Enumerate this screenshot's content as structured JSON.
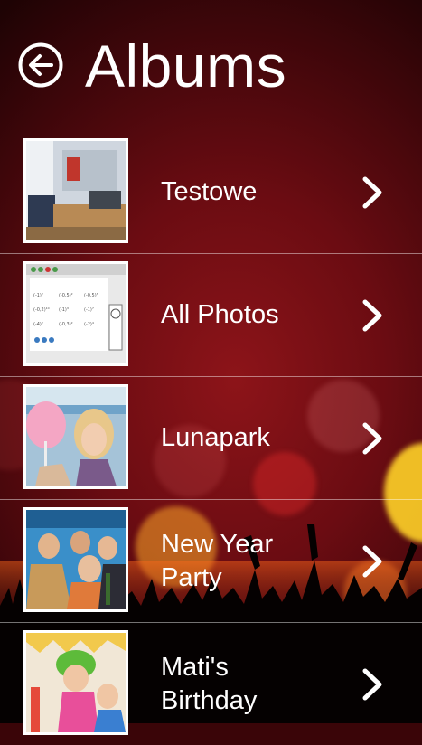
{
  "header": {
    "title": "Albums",
    "back_icon": "back-arrow-circle-icon"
  },
  "albums": [
    {
      "name": "Testowe",
      "thumb_icon": "photo-thumbnail-icon",
      "chevron_icon": "chevron-right-icon"
    },
    {
      "name": "All Photos",
      "thumb_icon": "photo-thumbnail-icon",
      "chevron_icon": "chevron-right-icon"
    },
    {
      "name": "Lunapark",
      "thumb_icon": "photo-thumbnail-icon",
      "chevron_icon": "chevron-right-icon"
    },
    {
      "name": "New Year\nParty",
      "thumb_icon": "photo-thumbnail-icon",
      "chevron_icon": "chevron-right-icon"
    },
    {
      "name": "Mati's\nBirthday",
      "thumb_icon": "photo-thumbnail-icon",
      "chevron_icon": "chevron-right-icon"
    }
  ],
  "colors": {
    "background": "#6b0c12",
    "text": "#ffffff",
    "divider": "#ffffff"
  }
}
